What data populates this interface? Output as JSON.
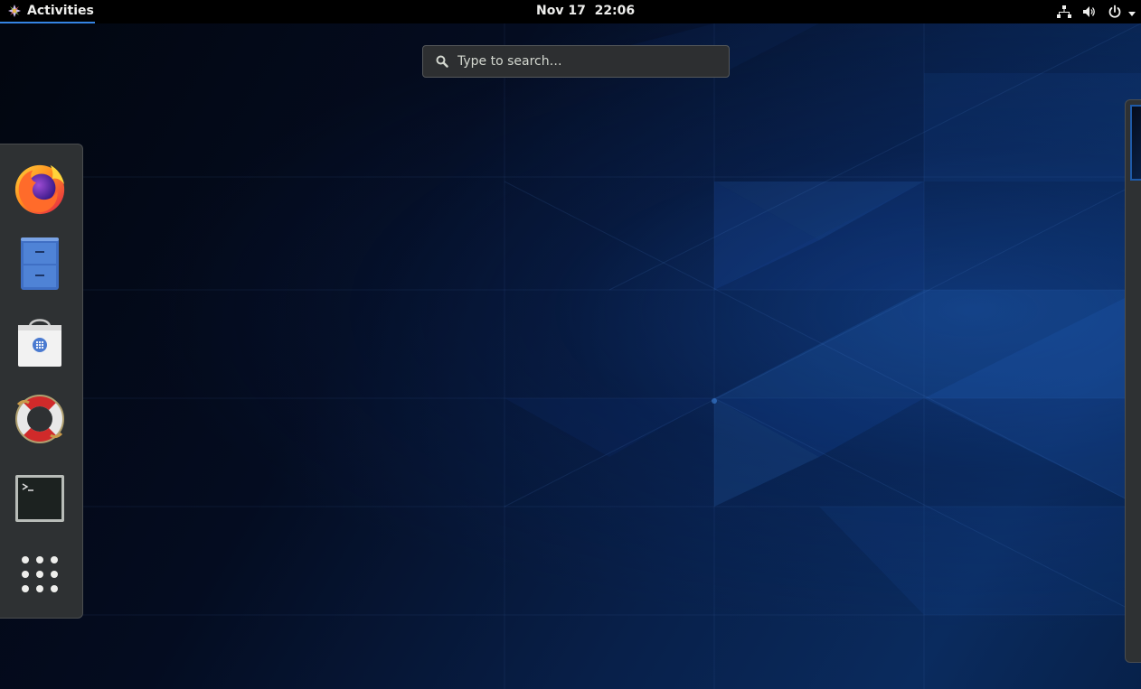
{
  "top_bar": {
    "activities_label": "Activities",
    "clock_date": "Nov 17",
    "clock_time": "22:06",
    "status_icons": [
      "network-icon",
      "volume-icon",
      "power-icon",
      "chevron-down-icon"
    ]
  },
  "search": {
    "placeholder": "Type to search…",
    "value": ""
  },
  "dash": {
    "items": [
      {
        "name": "Firefox",
        "icon": "firefox-icon"
      },
      {
        "name": "Files",
        "icon": "file-cabinet-icon"
      },
      {
        "name": "Software",
        "icon": "software-bag-icon"
      },
      {
        "name": "Help",
        "icon": "lifebuoy-icon"
      },
      {
        "name": "Terminal",
        "icon": "terminal-icon"
      },
      {
        "name": "Show Applications",
        "icon": "app-grid-icon"
      }
    ]
  },
  "colors": {
    "accent": "#3584e4",
    "panel": "#000000",
    "dash_bg": "#2e3133"
  }
}
